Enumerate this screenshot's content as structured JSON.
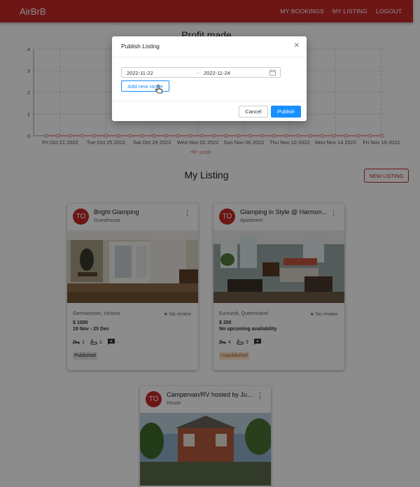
{
  "app": {
    "brand": "AirBrB",
    "nav": [
      "MY BOOKINGS",
      "MY LISTING",
      "LOGOUT"
    ]
  },
  "chart_data": {
    "type": "line",
    "title": "Profit made",
    "x": [
      "Fri Oct 21 2022",
      "Tue Oct 25 2022",
      "Sat Oct 29 2022",
      "Wed Nov 02 2022",
      "Sun Nov 06 2022",
      "Thu Nov 10 2022",
      "Mon Nov 14 2022",
      "Fri Nov 18 2022"
    ],
    "series": [
      {
        "name": "profit",
        "color": "#e57373",
        "values": [
          0,
          0,
          0,
          0,
          0,
          0,
          0,
          0
        ]
      }
    ],
    "point_count": 29,
    "ylim": [
      0,
      4
    ],
    "yticks": [
      "0",
      "1",
      "2",
      "3",
      "4"
    ],
    "grid": true,
    "legend": "bottom"
  },
  "listing": {
    "title": "My Listing",
    "new_button": "NEW LISTING",
    "cards": [
      {
        "avatar": "TO",
        "title": "Bright Glamping",
        "type": "Guesthouse",
        "location": "Germantown, Victoria",
        "review": "No review",
        "price": "$ 1000",
        "availability": "18 Nov - 25 Dec",
        "beds": "1",
        "baths": "1",
        "reviews_count": "-",
        "status": "Published",
        "status_color": "#e8e8e8"
      },
      {
        "avatar": "TO",
        "title": "Glamping in Style @ Harmon...",
        "type": "Apartment",
        "location": "Eumundi, Queensland",
        "review": "No review",
        "price": "$ 200",
        "availability": "No upcoming availability",
        "beds": "4",
        "baths": "3",
        "reviews_count": "-",
        "status": "Unpublished",
        "status_color": "#ffe6c7"
      },
      {
        "avatar": "TO",
        "title": "Campervan/RV hosted by Ju...",
        "type": "House"
      }
    ]
  },
  "modal": {
    "title": "Publish Listing",
    "start_date": "2022-11-22",
    "end_date": "2022-11-24",
    "add_range": "Add new range",
    "cancel": "Cancel",
    "publish": "Publish"
  }
}
